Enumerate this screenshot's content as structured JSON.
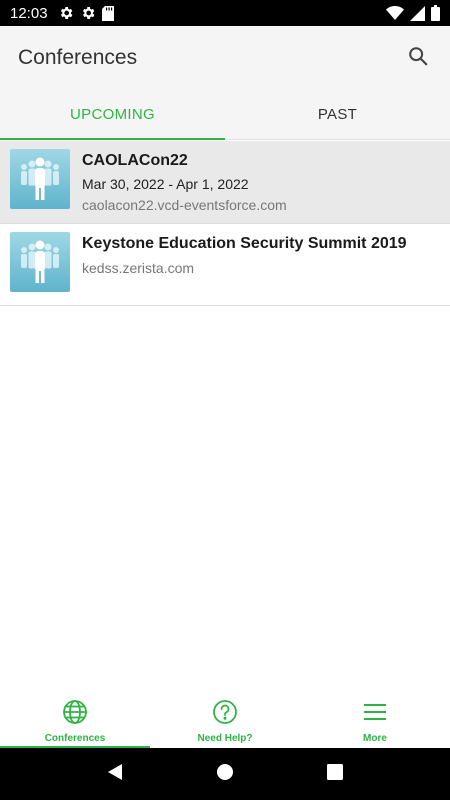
{
  "status_bar": {
    "time": "12:03",
    "left_icons": [
      "gear-icon",
      "gear-icon",
      "sd-card-icon"
    ],
    "right_icons": [
      "wifi-icon",
      "signal-icon",
      "battery-icon"
    ]
  },
  "app_bar": {
    "title": "Conferences",
    "search_icon": "search-icon"
  },
  "tabs": [
    {
      "label": "UPCOMING",
      "active": true
    },
    {
      "label": "PAST",
      "active": false
    }
  ],
  "conferences": [
    {
      "title": "CAOLACon22",
      "dates": "Mar 30, 2022 - Apr 1, 2022",
      "url": "caolacon22.vcd-eventsforce.com",
      "selected": true
    },
    {
      "title": "Keystone Education Security Summit 2019",
      "dates": "",
      "url": "kedss.zerista.com",
      "selected": false
    }
  ],
  "bottom_nav": [
    {
      "label": "Conferences",
      "icon": "globe-icon",
      "active": true
    },
    {
      "label": "Need Help?",
      "icon": "help-circle-icon",
      "active": false
    },
    {
      "label": "More",
      "icon": "menu-icon",
      "active": false
    }
  ],
  "system_nav": [
    "back-icon",
    "home-icon",
    "recents-icon"
  ],
  "colors": {
    "accent": "#2fb344",
    "app_bar_bg": "#f5f5f5",
    "selected_row_bg": "#e9e9e9"
  }
}
